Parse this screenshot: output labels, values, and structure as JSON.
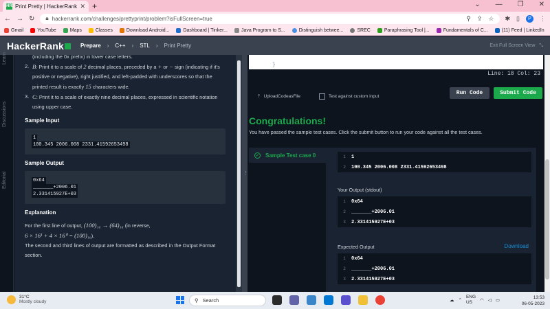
{
  "browser": {
    "tab_title": "Print Pretty | HackerRank",
    "tab_favicon": "HR",
    "url": "hackerrank.com/challenges/prettyprint/problem?isFullScreen=true",
    "profile_initial": "P",
    "bookmarks": [
      "Gmail",
      "YouTube",
      "Maps",
      "Classes",
      "Download Android...",
      "Dashboard | Tinker...",
      "Java Program to S...",
      "Distinguish betwee...",
      "SREC",
      "Paraphrasing Tool |...",
      "Fundamentals of C...",
      "(11) Feed | LinkedIn"
    ]
  },
  "header": {
    "logo": "HackerRank",
    "crumb_prepare": "Prepare",
    "crumb_lang": "C++",
    "crumb_section": "STL",
    "crumb_problem": "Print Pretty",
    "exit_fullscreen": "Exit Full Screen View"
  },
  "sidetabs": {
    "learn": "Learn",
    "discussions": "Discussions",
    "editorial": "Editorial"
  },
  "problem": {
    "top_line": "(including the 0x prefix) in lower case letters.",
    "item2_letter": "B",
    "item2_line1a": ": Print it to a scale of ",
    "item2_two": "2",
    "item2_line1b": " decimal places, preceded by a ",
    "item2_plus": "+",
    "item2_or": " or ",
    "item2_minus": "−",
    "item2_line1c": " sign (indicating if it's",
    "item2_line2": "positive or negative), right justified, and left-padded with underscores so that the",
    "item2_line3a": "printed result is exactly ",
    "item2_fifteen": "15",
    "item2_line3b": " characters wide.",
    "item3_letter": "C",
    "item3_line1": ": Print it to a scale of exactly nine decimal places, expressed in scientific notation",
    "item3_line2": "using upper case.",
    "sample_input_title": "Sample Input",
    "sample_input": [
      "1",
      "100.345 2006.008 2331.41592653498"
    ],
    "sample_output_title": "Sample Output",
    "sample_output": [
      "0x64",
      "_______+2006.01",
      "2.331415927E+03"
    ],
    "explanation_title": "Explanation",
    "expl_line1a": "For the first line of output, ",
    "expl_math1": "(100)₁₀ → (64)₁₆",
    "expl_line1b": " (in reverse,",
    "expl_math2": "6 × 16¹ + 4 × 16⁰ = (100)₁₀",
    "expl_line2b": ").",
    "expl_line3": "The second and third lines of output are formatted as described in the Output Format",
    "expl_line4": "section."
  },
  "editor": {
    "closing_brace": "}",
    "line_col": "Line: 18  Col: 23",
    "upload_label": "UploadCodeasFile",
    "custom_input_label": "Test against custom input",
    "run_label": "Run Code",
    "submit_label": "Submit Code"
  },
  "result": {
    "heading": "Congratulations!",
    "message": "You have passed the sample test cases. Click the submit button to run your code against all the test cases.",
    "test_case_label": "Sample Test case 0",
    "input_lines": [
      "1",
      "100.345 2006.008 2331.41592653498"
    ],
    "your_output_label": "Your Output (stdout)",
    "your_output": [
      "0x64",
      "_______+2006.01",
      "2.331415927E+03"
    ],
    "expected_output_label": "Expected Output",
    "download_label": "Download",
    "expected_output": [
      "0x64",
      "_______+2006.01",
      "2.331415927E+03"
    ]
  },
  "taskbar": {
    "weather_temp": "31°C",
    "weather_desc": "Mostly cloudy",
    "search_placeholder": "Search",
    "lang_1": "ENG",
    "lang_2": "US",
    "time": "13:53",
    "date": "06-05-2023"
  }
}
